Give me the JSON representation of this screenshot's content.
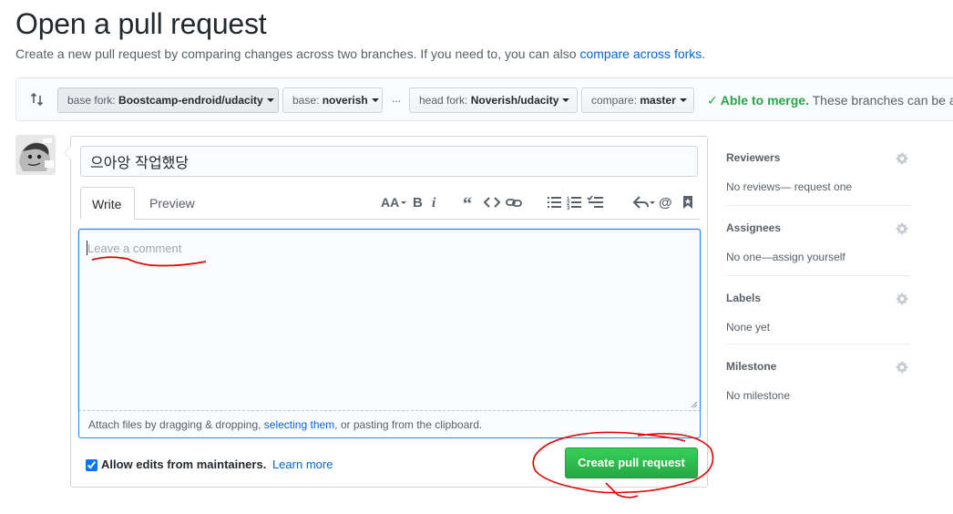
{
  "page": {
    "title": "Open a pull request",
    "subtitle_text": "Create a new pull request by comparing changes across two branches. If you need to, you can also ",
    "subtitle_link": "compare across forks",
    "subtitle_end": "."
  },
  "range": {
    "base_fork_label": "base fork:",
    "base_fork_value": "Boostcamp-endroid/udacity",
    "base_label": "base:",
    "base_value": "noverish",
    "separator": "...",
    "head_fork_label": "head fork:",
    "head_fork_value": "Noverish/udacity",
    "compare_label": "compare:",
    "compare_value": "master",
    "merge_status": "Able to merge.",
    "merge_detail": "These branches can be au"
  },
  "composer": {
    "title_value": "으아앙 작업했당",
    "tabs": [
      {
        "label": "Write"
      },
      {
        "label": "Preview"
      }
    ],
    "toolbar_icons": [
      "header-icon",
      "bold-icon",
      "italic-icon",
      "quote-icon",
      "code-icon",
      "link-icon",
      "unordered-list-icon",
      "ordered-list-icon",
      "task-list-icon",
      "reply-icon",
      "mention-icon",
      "bookmark-icon"
    ],
    "comment_placeholder": "Leave a comment",
    "attach_text_1": "Attach files by dragging & dropping, ",
    "attach_link": "selecting them",
    "attach_text_2": ", or pasting from the clipboard.",
    "allow_edits_label": "Allow edits from maintainers.",
    "allow_edits_checked": true,
    "learn_more": "Learn more",
    "create_button": "Create pull request"
  },
  "sidebar": {
    "reviewers": {
      "heading": "Reviewers",
      "value_1": "No reviews",
      "value_2": "— request one"
    },
    "assignees": {
      "heading": "Assignees",
      "value_1": "No one",
      "value_2": "—assign yourself"
    },
    "labels": {
      "heading": "Labels",
      "value": "None yet"
    },
    "milestone": {
      "heading": "Milestone",
      "value": "No milestone"
    }
  },
  "colors": {
    "accent_link": "#0366d6",
    "merge_green": "#28a745",
    "button_green": "#2ea44f",
    "annotation_red": "#e00000"
  }
}
